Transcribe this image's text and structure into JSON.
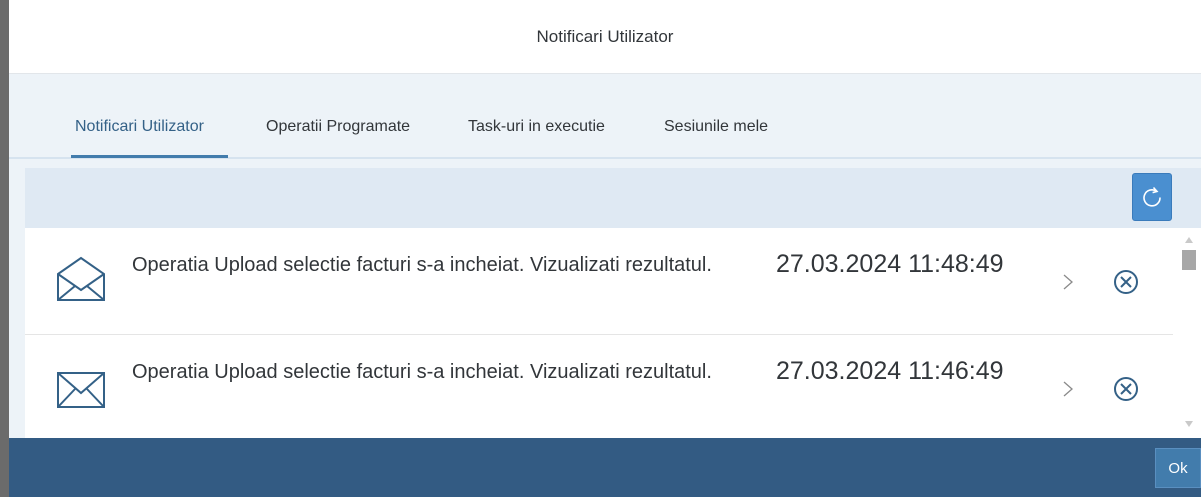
{
  "dialog": {
    "title": "Notificari Utilizator"
  },
  "tabs": [
    {
      "label": "Notificari Utilizator",
      "active": true
    },
    {
      "label": "Operatii Programate",
      "active": false
    },
    {
      "label": "Task-uri in executie",
      "active": false
    },
    {
      "label": "Sesiunile mele",
      "active": false
    }
  ],
  "toolbar": {
    "refresh_icon": "refresh-icon"
  },
  "notifications": [
    {
      "icon": "mail-icon",
      "text": "Operatia Upload selectie facturi s-a incheiat. Vizualizati rezultatul.",
      "datetime": "27.03.2024 11:48:49"
    },
    {
      "icon": "mail-icon",
      "text": "Operatia Upload selectie facturi s-a incheiat. Vizualizati rezultatul.",
      "datetime": "27.03.2024 11:46:49"
    }
  ],
  "footer": {
    "ok_label": "Ok"
  },
  "colors": {
    "accent": "#427cac",
    "footer": "#335b83",
    "refresh": "#4a8fd0",
    "icon": "#346187"
  }
}
